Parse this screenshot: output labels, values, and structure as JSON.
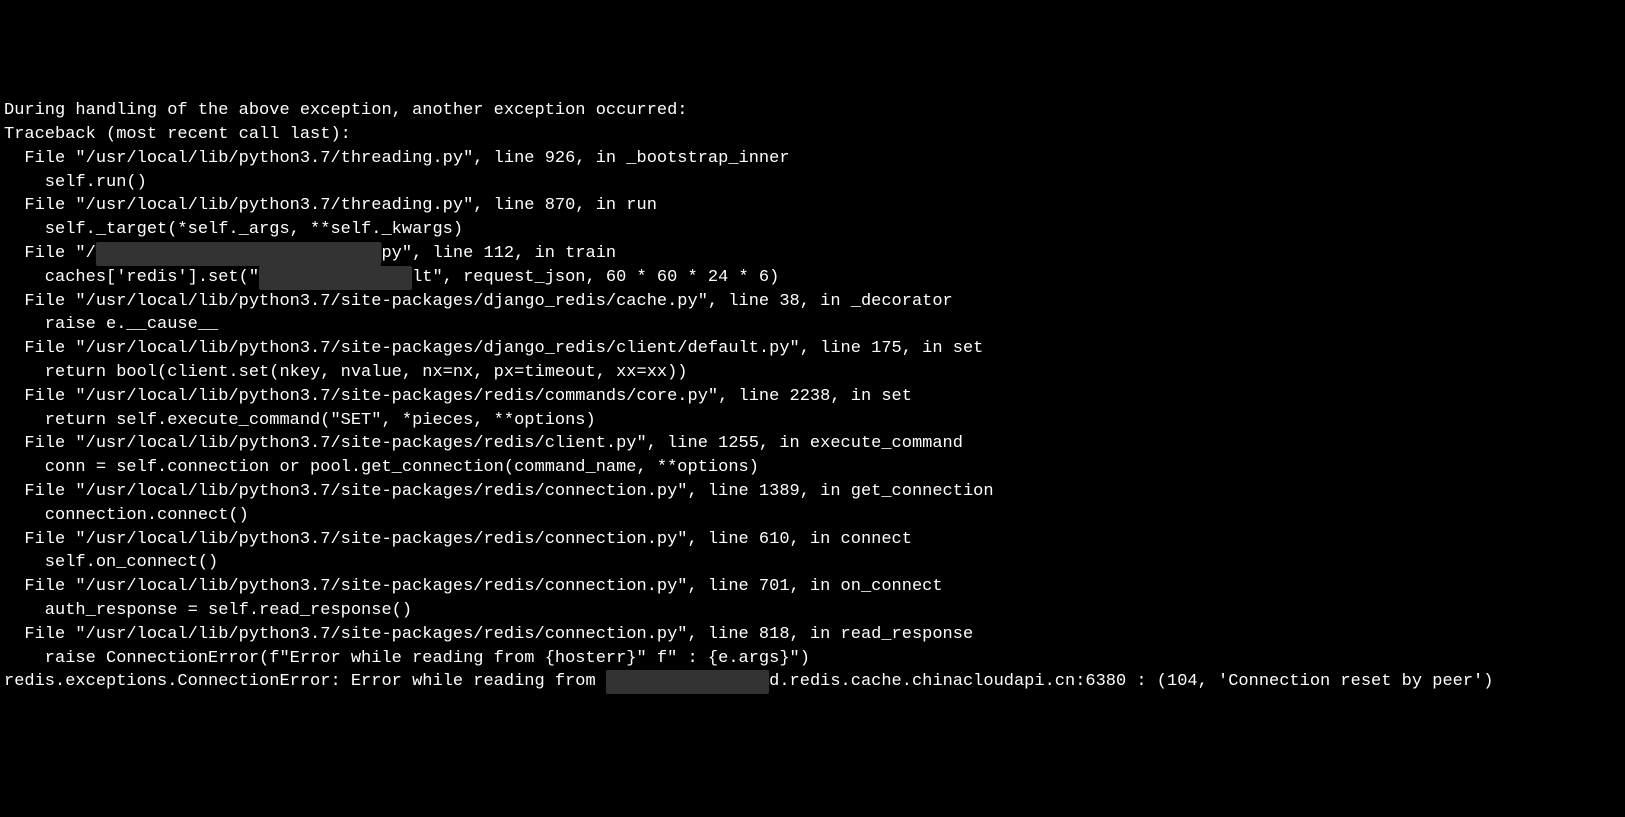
{
  "terminal": {
    "header": "During handling of the above exception, another exception occurred:",
    "blank": "",
    "traceback_header": "Traceback (most recent call last):",
    "frames": [
      {
        "file": "  File \"/usr/local/lib/python3.7/threading.py\", line 926, in _bootstrap_inner",
        "code": "    self.run()"
      },
      {
        "file": "  File \"/usr/local/lib/python3.7/threading.py\", line 870, in run",
        "code": "    self._target(*self._args, **self._kwargs)"
      },
      {
        "file_prefix": "  File \"/",
        "file_redacted": "████████████████████████████",
        "file_suffix": "py\", line 112, in train",
        "code_prefix": "    caches['redis'].set(\"",
        "code_redacted": "███████████████",
        "code_suffix": "lt\", request_json, 60 * 60 * 24 * 6)"
      },
      {
        "file": "  File \"/usr/local/lib/python3.7/site-packages/django_redis/cache.py\", line 38, in _decorator",
        "code": "    raise e.__cause__"
      },
      {
        "file": "  File \"/usr/local/lib/python3.7/site-packages/django_redis/client/default.py\", line 175, in set",
        "code": "    return bool(client.set(nkey, nvalue, nx=nx, px=timeout, xx=xx))"
      },
      {
        "file": "  File \"/usr/local/lib/python3.7/site-packages/redis/commands/core.py\", line 2238, in set",
        "code": "    return self.execute_command(\"SET\", *pieces, **options)"
      },
      {
        "file": "  File \"/usr/local/lib/python3.7/site-packages/redis/client.py\", line 1255, in execute_command",
        "code": "    conn = self.connection or pool.get_connection(command_name, **options)"
      },
      {
        "file": "  File \"/usr/local/lib/python3.7/site-packages/redis/connection.py\", line 1389, in get_connection",
        "code": "    connection.connect()"
      },
      {
        "file": "  File \"/usr/local/lib/python3.7/site-packages/redis/connection.py\", line 610, in connect",
        "code": "    self.on_connect()"
      },
      {
        "file": "  File \"/usr/local/lib/python3.7/site-packages/redis/connection.py\", line 701, in on_connect",
        "code": "    auth_response = self.read_response()"
      },
      {
        "file": "  File \"/usr/local/lib/python3.7/site-packages/redis/connection.py\", line 818, in read_response",
        "code": "    raise ConnectionError(f\"Error while reading from {hosterr}\" f\" : {e.args}\")"
      }
    ],
    "error_prefix": "redis.exceptions.ConnectionError: Error while reading from ",
    "error_redacted": "████████████████",
    "error_suffix": "d.redis.cache.chinacloudapi.cn:6380 : (104, 'Connection reset by peer')"
  }
}
